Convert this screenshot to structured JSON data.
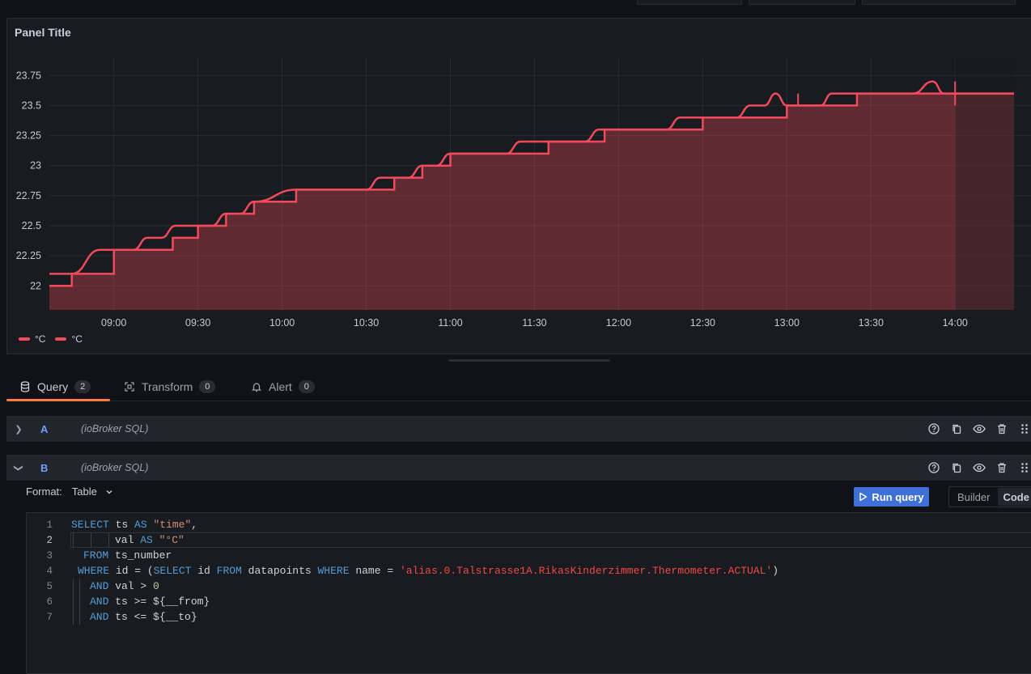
{
  "panel": {
    "title": "Panel Title"
  },
  "chart_data": {
    "type": "line",
    "title": "Panel Title",
    "ylim": [
      21.8,
      23.9
    ],
    "y_ticks": [
      "23.75",
      "23.5",
      "23.25",
      "23",
      "22.75",
      "22.5",
      "22.25",
      "22"
    ],
    "x_ticks": [
      "09:00",
      "09:30",
      "10:00",
      "10:30",
      "11:00",
      "11:30",
      "12:00",
      "12:30",
      "13:00",
      "13:30",
      "14:00",
      "14:"
    ],
    "grid": true,
    "legend": "bottom-left",
    "series": [
      {
        "name": "°C",
        "color": "#f2495c",
        "step": "after",
        "points": [
          [
            "08:37",
            22.0
          ],
          [
            "08:45",
            22.1
          ],
          [
            "09:00",
            22.3
          ],
          [
            "09:21",
            22.4
          ],
          [
            "09:30",
            22.5
          ],
          [
            "09:40",
            22.6
          ],
          [
            "09:50",
            22.7
          ],
          [
            "10:05",
            22.8
          ],
          [
            "10:40",
            22.9
          ],
          [
            "10:50",
            23.0
          ],
          [
            "11:00",
            23.1
          ],
          [
            "11:35",
            23.2
          ],
          [
            "11:55",
            23.3
          ],
          [
            "12:30",
            23.4
          ],
          [
            "13:00",
            23.5
          ],
          [
            "13:25",
            23.6
          ],
          [
            "14:00",
            23.6
          ],
          [
            "14:21",
            23.6
          ]
        ]
      },
      {
        "name": "°C",
        "color": "#f2495c",
        "step": "smooth",
        "points": [
          [
            "08:37",
            22.1
          ],
          [
            "08:45",
            22.1
          ],
          [
            "08:55",
            22.3
          ],
          [
            "09:07",
            22.3
          ],
          [
            "09:12",
            22.4
          ],
          [
            "09:17",
            22.4
          ],
          [
            "09:22",
            22.5
          ],
          [
            "09:35",
            22.5
          ],
          [
            "09:40",
            22.6
          ],
          [
            "09:45",
            22.6
          ],
          [
            "09:50",
            22.7
          ],
          [
            "10:05",
            22.8
          ],
          [
            "10:30",
            22.8
          ],
          [
            "10:35",
            22.9
          ],
          [
            "10:45",
            22.9
          ],
          [
            "10:50",
            23.0
          ],
          [
            "10:55",
            23.0
          ],
          [
            "11:00",
            23.1
          ],
          [
            "11:20",
            23.1
          ],
          [
            "11:25",
            23.2
          ],
          [
            "11:48",
            23.2
          ],
          [
            "11:53",
            23.3
          ],
          [
            "12:17",
            23.3
          ],
          [
            "12:22",
            23.4
          ],
          [
            "12:42",
            23.4
          ],
          [
            "12:47",
            23.5
          ],
          [
            "12:52",
            23.5
          ],
          [
            "12:56",
            23.6
          ],
          [
            "13:00",
            23.5
          ],
          [
            "13:12",
            23.5
          ],
          [
            "13:16",
            23.6
          ],
          [
            "13:45",
            23.6
          ],
          [
            "13:52",
            23.7
          ],
          [
            "13:56",
            23.6
          ],
          [
            "14:21",
            23.6
          ]
        ]
      }
    ]
  },
  "legend": {
    "items": [
      "°C",
      "°C"
    ]
  },
  "tabs": [
    {
      "label": "Query",
      "count": "2"
    },
    {
      "label": "Transform",
      "count": "0"
    },
    {
      "label": "Alert",
      "count": "0"
    }
  ],
  "queries": [
    {
      "name": "A",
      "source": "(ioBroker SQL)"
    },
    {
      "name": "B",
      "source": "(ioBroker SQL)"
    }
  ],
  "format": {
    "label": "Format:",
    "value": "Table"
  },
  "run_query_label": "Run query",
  "mode_toggle": {
    "builder": "Builder",
    "code": "Code"
  },
  "sql": {
    "line_numbers": [
      "1",
      "2",
      "3",
      "4",
      "5",
      "6",
      "7"
    ],
    "l1": {
      "kw1": "SELECT",
      "t1": " ts ",
      "kw2": "AS",
      "s1": " \"time\"",
      "t2": ","
    },
    "l2": {
      "t1": "val ",
      "kw1": "AS",
      "s1": " \"°C\""
    },
    "l3": {
      "kw1": "FROM",
      "t1": " ts_number"
    },
    "l4": {
      "kw1": "WHERE",
      "t1": " id = (",
      "kw2": "SELECT",
      "t2": " id ",
      "kw3": "FROM",
      "t3": " datapoints ",
      "kw4": "WHERE",
      "t4": " name = ",
      "s1": "'alias.0.Talstrasse1A.RikasKinderzimmer.Thermometer.ACTUAL'",
      "t5": ")"
    },
    "l5": {
      "kw1": "AND",
      "t1": " val > ",
      "n1": "0"
    },
    "l6": {
      "kw1": "AND",
      "t1": " ts >= ${__from}"
    },
    "l7": {
      "kw1": "AND",
      "t1": " ts <= ${__to}"
    }
  }
}
